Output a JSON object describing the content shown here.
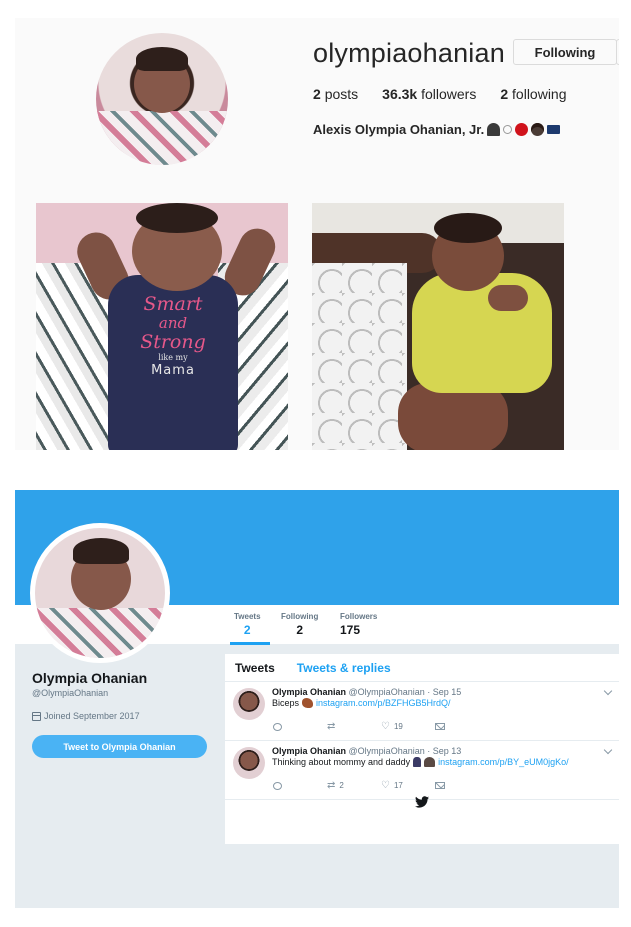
{
  "instagram": {
    "username": "olympiaohanian",
    "follow_button": "Following",
    "stats": {
      "posts_count": "2",
      "posts_label": "posts",
      "followers_count": "36.3k",
      "followers_label": "followers",
      "following_count": "2",
      "following_label": "following"
    },
    "full_name": "Alexis Olympia Ohanian, Jr.",
    "bio_emojis": [
      "runner-emoji",
      "female-sign-emoji",
      "red-heart-emoji",
      "face-emoji",
      "laptop-emoji"
    ],
    "photos": [
      {
        "onesie_line1": "Smart",
        "onesie_line2": "and",
        "onesie_line3": "Strong",
        "onesie_line4": "like my",
        "onesie_line5": "Mama"
      },
      {}
    ]
  },
  "twitter": {
    "stats": [
      {
        "label": "Tweets",
        "value": "2"
      },
      {
        "label": "Following",
        "value": "2"
      },
      {
        "label": "Followers",
        "value": "175"
      }
    ],
    "name": "Olympia Ohanian",
    "handle": "@OlympiaOhanian",
    "joined": "Joined September 2017",
    "tweet_to_button": "Tweet to Olympia Ohanian",
    "tabs": [
      "Tweets",
      "Tweets & replies"
    ],
    "tweets": [
      {
        "name": "Olympia Ohanian",
        "handle_date": "@OlympiaOhanian · Sep 15",
        "text": "Biceps",
        "link": "instagram.com/p/BZFHGB5HrdQ/",
        "reply_count": "",
        "retweet_count": "",
        "like_count": "19"
      },
      {
        "name": "Olympia Ohanian",
        "handle_date": "@OlympiaOhanian · Sep 13",
        "text": "Thinking about mommy and daddy",
        "link": "instagram.com/p/BY_eUM0jgKo/",
        "reply_count": "",
        "retweet_count": "2",
        "like_count": "17"
      }
    ],
    "colors": {
      "brand": "#1da1f2",
      "header": "#2fa2ea"
    }
  }
}
